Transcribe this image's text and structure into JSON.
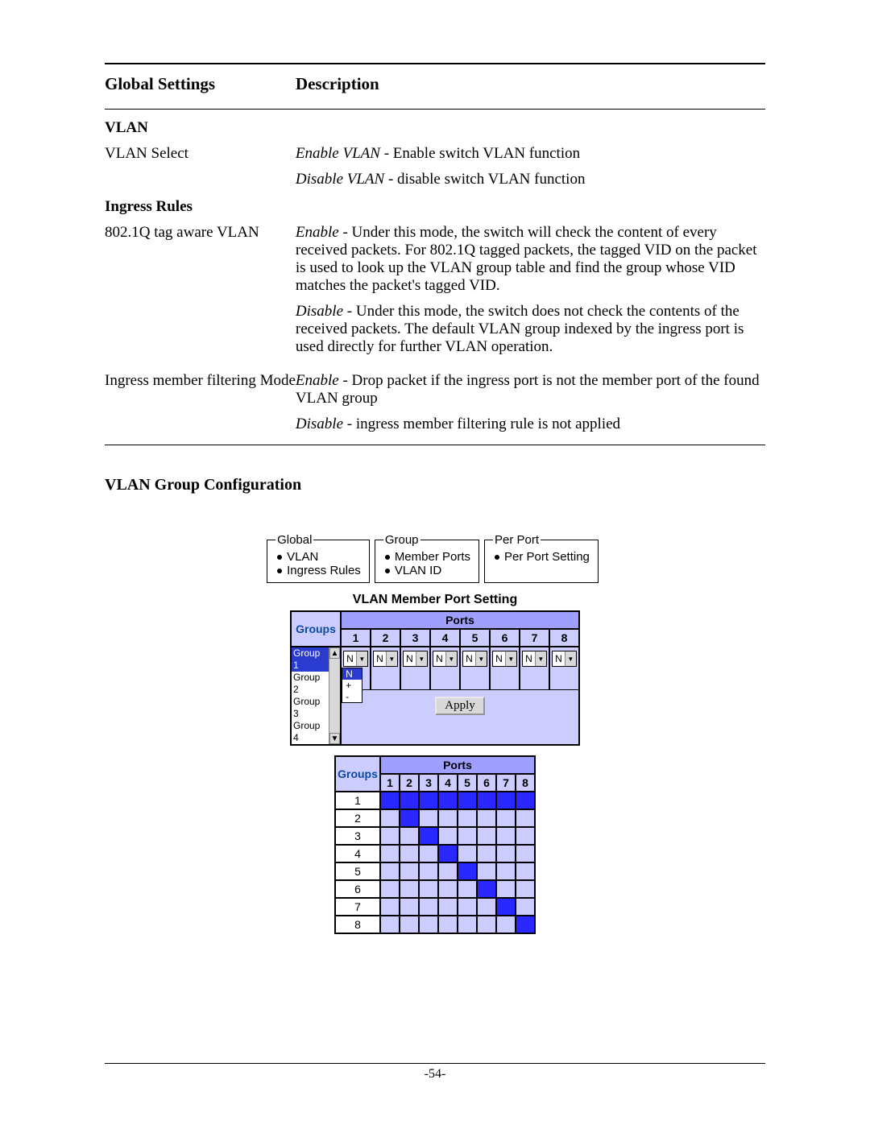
{
  "table": {
    "header1": "Global Settings",
    "header2": "Description",
    "vlan_section": "VLAN",
    "vlan_select_label": "VLAN Select",
    "vlan_select_desc1_em": "Enable VLAN",
    "vlan_select_desc1": " - Enable switch VLAN function",
    "vlan_select_desc2_em": "Disable VLAN",
    "vlan_select_desc2": " - disable switch VLAN function",
    "ingress_section": "Ingress Rules",
    "tagaware_label": "802.1Q tag aware VLAN",
    "tagaware_enable_em": "Enable",
    "tagaware_enable_txt": " - Under this mode, the switch will check the content of every received packets. For 802.1Q tagged packets, the tagged VID on the packet is used to look up the VLAN group table and find the group whose VID matches the packet's tagged VID.",
    "tagaware_disable_em": "Disable",
    "tagaware_disable_txt": " - Under this mode, the switch does not check the contents of the received packets. The default VLAN group indexed by the ingress port is used directly for further VLAN operation.",
    "imf_label": "Ingress member filtering Mode",
    "imf_enable_em": "Enable",
    "imf_enable_txt": " - Drop packet if the ingress port is not the member port of the found VLAN group",
    "imf_disable_em": "Disable",
    "imf_disable_txt": " - ingress member filtering rule is not applied"
  },
  "vlan_config_title": "VLAN Group Configuration",
  "fieldsets": {
    "global_legend": "Global",
    "global_item1": "VLAN",
    "global_item2": "Ingress Rules",
    "group_legend": "Group",
    "group_item1": "Member Ports",
    "group_item2": "VLAN ID",
    "perport_legend": "Per Port",
    "perport_item1": "Per Port Setting"
  },
  "mps": {
    "title": "VLAN Member Port Setting",
    "groups_label": "Groups",
    "ports_label": "Ports",
    "port_nums": [
      "1",
      "2",
      "3",
      "4",
      "5",
      "6",
      "7",
      "8"
    ],
    "group_items": [
      "Group 1",
      "Group 2",
      "Group 3",
      "Group 4"
    ],
    "dropdown_value": "N",
    "dropdown_option_sel": "N",
    "dropdown_option_2": "+",
    "dropdown_option_3": "-",
    "apply_label": "Apply"
  },
  "status": {
    "groups_label": "Groups",
    "ports_label": "Ports",
    "port_nums": [
      "1",
      "2",
      "3",
      "4",
      "5",
      "6",
      "7",
      "8"
    ],
    "rows": [
      {
        "g": "1",
        "cells": [
          1,
          1,
          1,
          1,
          1,
          1,
          1,
          1
        ]
      },
      {
        "g": "2",
        "cells": [
          0,
          1,
          0,
          0,
          0,
          0,
          0,
          0
        ]
      },
      {
        "g": "3",
        "cells": [
          0,
          0,
          1,
          0,
          0,
          0,
          0,
          0
        ]
      },
      {
        "g": "4",
        "cells": [
          0,
          0,
          0,
          1,
          0,
          0,
          0,
          0
        ]
      },
      {
        "g": "5",
        "cells": [
          0,
          0,
          0,
          0,
          1,
          0,
          0,
          0
        ]
      },
      {
        "g": "6",
        "cells": [
          0,
          0,
          0,
          0,
          0,
          1,
          0,
          0
        ]
      },
      {
        "g": "7",
        "cells": [
          0,
          0,
          0,
          0,
          0,
          0,
          1,
          0
        ]
      },
      {
        "g": "8",
        "cells": [
          0,
          0,
          0,
          0,
          0,
          0,
          0,
          1
        ]
      }
    ]
  },
  "page_number": "-54-"
}
